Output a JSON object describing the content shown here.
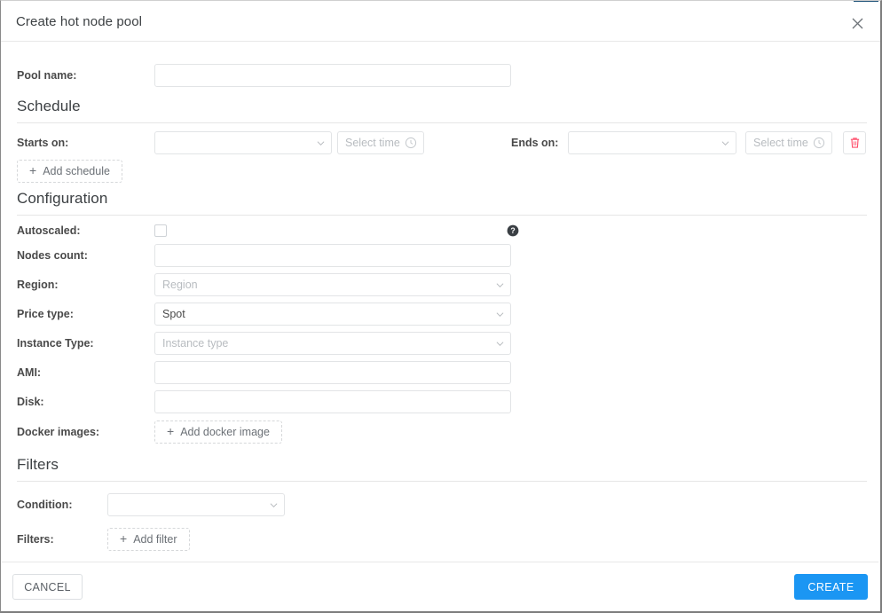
{
  "dialog": {
    "title": "Create hot node pool",
    "close_icon": "close-icon"
  },
  "fields": {
    "pool_name_label": "Pool name:",
    "pool_name_value": "",
    "pool_name_placeholder": ""
  },
  "schedule": {
    "heading": "Schedule",
    "starts_on_label": "Starts on:",
    "starts_on_value": "",
    "starts_on_time_placeholder": "Select time",
    "ends_on_label": "Ends on:",
    "ends_on_value": "",
    "ends_on_time_placeholder": "Select time",
    "delete_schedule_icon": "trash-icon",
    "add_schedule_label": "Add schedule",
    "add_icon": "plus-icon"
  },
  "configuration": {
    "heading": "Configuration",
    "autoscaled_label": "Autoscaled:",
    "autoscaled_checked": false,
    "autoscaled_help_icon": "help-circle-icon",
    "nodes_count_label": "Nodes count:",
    "nodes_count_value": "",
    "region_label": "Region:",
    "region_value": "",
    "region_placeholder": "Region",
    "price_type_label": "Price type:",
    "price_type_value": "Spot",
    "instance_type_label": "Instance Type:",
    "instance_type_value": "",
    "instance_type_placeholder": "Instance type",
    "ami_label": "AMI:",
    "ami_value": "",
    "disk_label": "Disk:",
    "disk_value": "",
    "docker_images_label": "Docker images:",
    "add_docker_image_label": "Add docker image"
  },
  "filters": {
    "heading": "Filters",
    "condition_label": "Condition:",
    "condition_value": "",
    "filters_label": "Filters:",
    "add_filter_label": "Add filter"
  },
  "footer": {
    "cancel_label": "CANCEL",
    "create_label": "CREATE"
  },
  "colors": {
    "primary": "#1b96f3",
    "danger": "#ff4d6a",
    "accent_strip": "#1f5278",
    "text": "#4a4a4a",
    "placeholder": "#b8bcc0",
    "border": "#e2e4e6"
  }
}
